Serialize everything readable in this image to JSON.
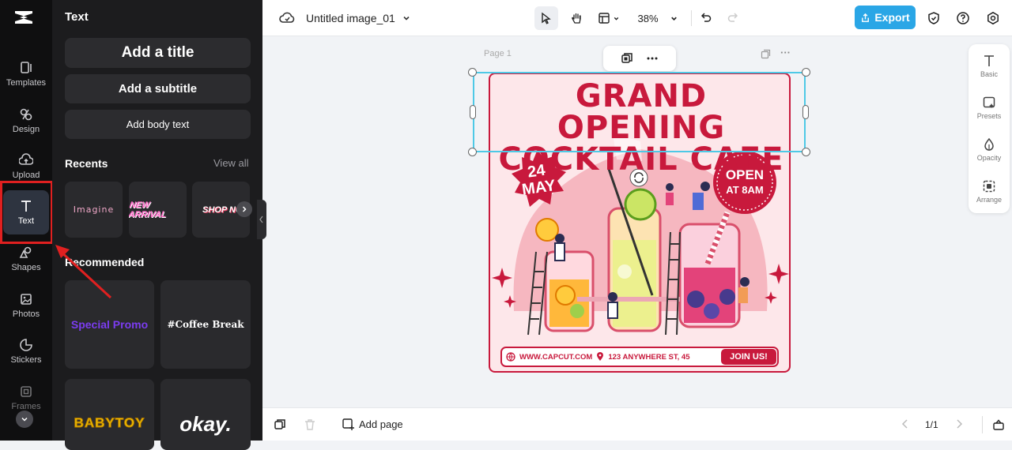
{
  "rail": {
    "items": [
      {
        "label": "Templates",
        "icon": "templates-icon"
      },
      {
        "label": "Design",
        "icon": "design-icon"
      },
      {
        "label": "Upload",
        "icon": "upload-icon"
      },
      {
        "label": "Text",
        "icon": "text-icon",
        "active": true
      },
      {
        "label": "Shapes",
        "icon": "shapes-icon"
      },
      {
        "label": "Photos",
        "icon": "photos-icon"
      },
      {
        "label": "Stickers",
        "icon": "stickers-icon"
      },
      {
        "label": "Frames",
        "icon": "frames-icon"
      }
    ]
  },
  "panel": {
    "title": "Text",
    "add_title": "Add a title",
    "add_subtitle": "Add a subtitle",
    "add_body": "Add body text",
    "recents_label": "Recents",
    "view_all": "View all",
    "recents": [
      "Imagine",
      "NEW ARRIVAL",
      "SHOP NOW"
    ],
    "recommended_label": "Recommended",
    "recommended": [
      "Special Promo",
      "#Coffee Break",
      "BABYTOY",
      "okay."
    ]
  },
  "topbar": {
    "doc_title": "Untitled image_01",
    "zoom": "38%",
    "export_label": "Export"
  },
  "canvas": {
    "page_label": "Page 1"
  },
  "poster": {
    "line1": "GRAND OPENING",
    "line2": "COCKTAIL CAFE",
    "date_line1": "24",
    "date_line2": "MAY",
    "open_line1": "OPEN",
    "open_line2": "AT 8AM",
    "website": "WWW.CAPCUT.COM",
    "address": "123 ANYWHERE ST, 45",
    "join": "JOIN US!"
  },
  "right_panel": {
    "items": [
      "Basic",
      "Presets",
      "Opacity",
      "Arrange"
    ]
  },
  "bottombar": {
    "add_page": "Add page",
    "pager": "1/1"
  },
  "colors": {
    "accent": "#2aa6e6",
    "poster_red": "#c8193c",
    "poster_pink": "#fde7ea",
    "highlight": "#e02020"
  }
}
